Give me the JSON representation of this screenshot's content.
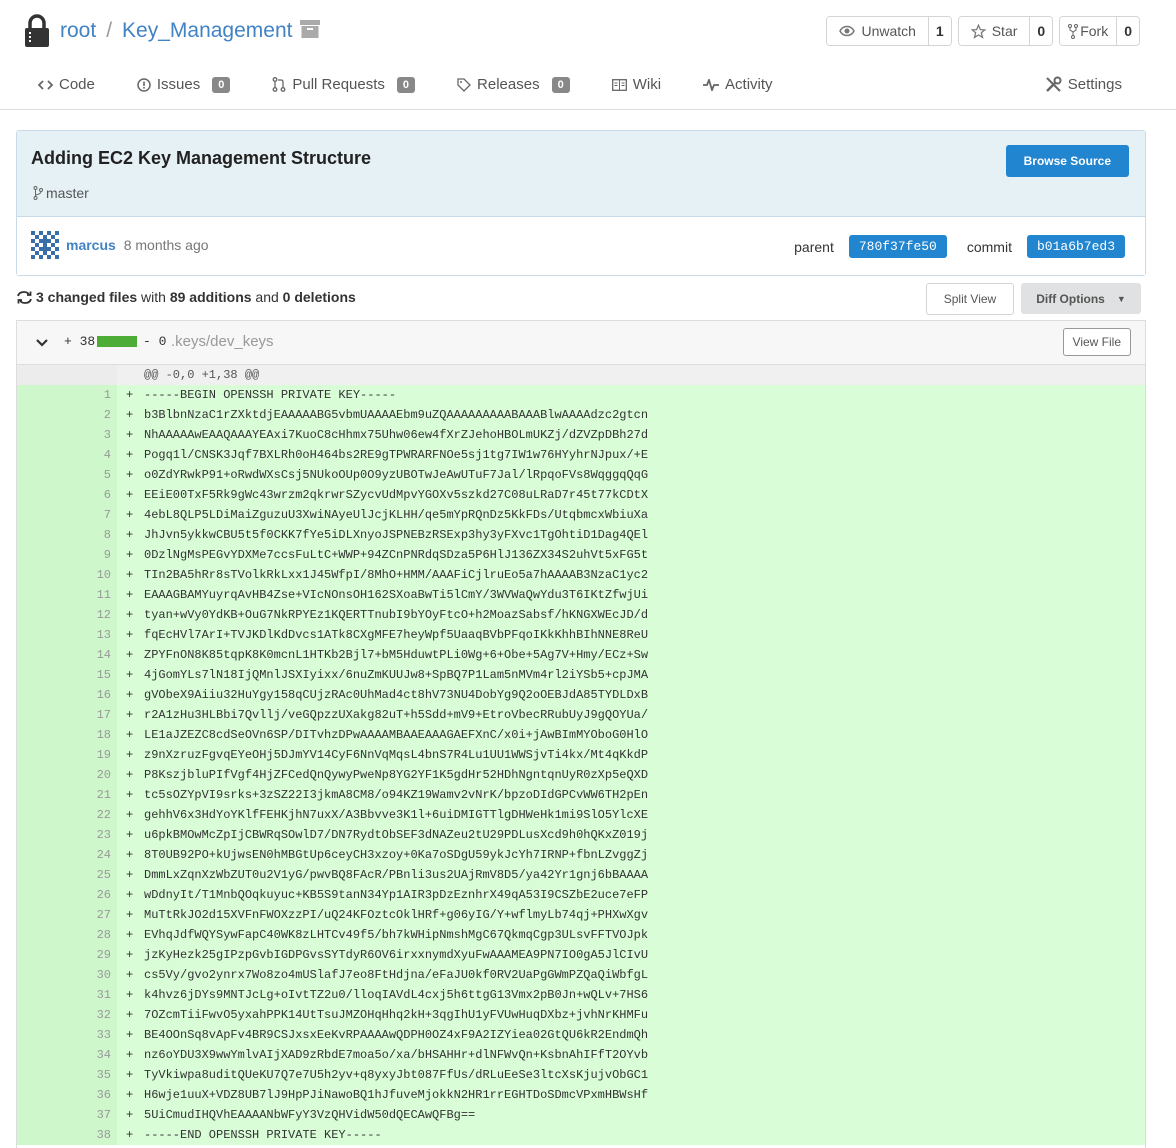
{
  "repo": {
    "owner": "root",
    "separator": "/",
    "name": "Key_Management",
    "buttons": [
      {
        "label": "Unwatch",
        "count": "1",
        "icon": "eye-icon"
      },
      {
        "label": "Star",
        "count": "0",
        "icon": "star-icon"
      },
      {
        "label": "Fork",
        "count": "0",
        "icon": "fork-icon"
      }
    ]
  },
  "tabs": [
    {
      "label": "Code",
      "icon": "code-icon"
    },
    {
      "label": "Issues",
      "badge": "0",
      "icon": "issue-icon"
    },
    {
      "label": "Pull Requests",
      "badge": "0",
      "icon": "pull-request-icon"
    },
    {
      "label": "Releases",
      "badge": "0",
      "icon": "tag-icon"
    },
    {
      "label": "Wiki",
      "icon": "book-icon"
    },
    {
      "label": "Activity",
      "icon": "pulse-icon"
    }
  ],
  "settings_label": "Settings",
  "commit": {
    "title": "Adding EC2 Key Management Structure",
    "branch": "master",
    "browse_label": "Browse Source",
    "author": "marcus",
    "time": "8 months ago",
    "parent_label": "parent",
    "parent_sha": "780f37fe50",
    "commit_label": "commit",
    "commit_sha": "b01a6b7ed3"
  },
  "stats": {
    "files": "3 changed files",
    "with": "with",
    "additions": "89 additions",
    "and": "and",
    "deletions": "0 deletions",
    "split_view": "Split View",
    "diff_options": "Diff Options"
  },
  "file": {
    "additions": "+ 38",
    "deletions": "- 0",
    "path": ".keys/dev_keys",
    "view_file": "View File",
    "hunk": "@@ -0,0 +1,38 @@",
    "lines": [
      "-----BEGIN OPENSSH PRIVATE KEY-----",
      "b3BlbnNzaC1rZXktdjEAAAAABG5vbmUAAAAEbm9uZQAAAAAAAAABAAABlwAAAAdzc2gtcn",
      "NhAAAAAwEAAQAAAYEAxi7KuoC8cHhmx75Uhw06ew4fXrZJehoHBOLmUKZj/dZVZpDBh27d",
      "Pogq1l/CNSK3Jqf7BXLRh0oH464bs2RE9gTPWRARFNOe5sj1tg7IW1w76HYyhrNJpux/+E",
      "o0ZdYRwkP91+oRwdWXsCsj5NUkoOUp0O9yzUBOTwJeAwUTuF7Jal/lRpqoFVs8WqggqQqG",
      "EEiE00TxF5Rk9gWc43wrzm2qkrwrSZycvUdMpvYGOXv5szkd27C08uLRaD7r45t77kCDtX",
      "4ebL8QLP5LDiMaiZguzuU3XwiNAyeUlJcjKLHH/qe5mYpRQnDz5KkFDs/UtqbmcxWbiuXa",
      "JhJvn5ykkwCBU5t5f0CKK7fYe5iDLXnyoJSPNEBzRSExp3hy3yFXvc1TgOhtiD1Dag4QEl",
      "0DzlNgMsPEGvYDXMe7ccsFuLtC+WWP+94ZCnPNRdqSDza5P6HlJ136ZX34S2uhVt5xFG5t",
      "TIn2BA5hRr8sTVolkRkLxx1J45WfpI/8MhO+HMM/AAAFiCjlruEo5a7hAAAAB3NzaC1yc2",
      "EAAAGBAMYuyrqAvHB4Zse+VIcNOnsOH162SXoaBwTi5lCmY/3WVWaQwYdu3T6IKtZfwjUi",
      "tyan+wVy0YdKB+OuG7NkRPYEz1KQERTTnubI9bYOyFtcO+h2MoazSabsf/hKNGXWEcJD/d",
      "fqEcHVl7ArI+TVJKDlKdDvcs1ATk8CXgMFE7heyWpf5UaaqBVbPFqoIKkKhhBIhNNE8ReU",
      "ZPYFnON8K85tqpK8K0mcnL1HTKb2Bjl7+bM5HduwtPLi0Wg+6+Obe+5Ag7V+Hmy/ECz+Sw",
      "4jGomYLs7lN18IjQMnlJSXIyixx/6nuZmKUUJw8+SpBQ7P1Lam5nMVm4rl2iYSb5+cpJMA",
      "gVObeX9Aiiu32HuYgy158qCUjzRAc0UhMad4ct8hV73NU4DobYg9Q2oOEBJdA85TYDLDxB",
      "r2A1zHu3HLBbi7Qvllj/veGQpzzUXakg82uT+h5Sdd+mV9+EtroVbecRRubUyJ9gQOYUa/",
      "LE1aJZEZC8cdSeOVn6SP/DITvhzDPwAAAAMBAAEAAAGAEFXnC/x0i+jAwBImMYOboG0HlO",
      "z9nXzruzFgvqEYeOHj5DJmYV14CyF6NnVqMqsL4bnS7R4Lu1UU1WWSjvTi4kx/Mt4qKkdP",
      "P8KszjbluPIfVgf4HjZFCedQnQywyPweNp8YG2YF1K5gdHr52HDhNgntqnUyR0zXp5eQXD",
      "tc5sOZYpVI9srks+3zSZ22I3jkmA8CM8/o94KZ19Wamv2vNrK/bpzoDIdGPCvWW6TH2pEn",
      "gehhV6x3HdYoYKlfFEHKjhN7uxX/A3Bbvve3K1l+6uiDMIGTTlgDHWeHk1mi9SlO5YlcXE",
      "u6pkBMOwMcZpIjCBWRqSOwlD7/DN7RydtObSEF3dNAZeu2tU29PDLusXcd9h0hQKxZ019j",
      "8T0UB92PO+kUjwsEN0hMBGtUp6ceyCH3xzoy+0Ka7oSDgU59ykJcYh7IRNP+fbnLZvggZj",
      "DmmLxZqnXzWbZUT0u2V1yG/pwvBQ8FAcR/PBnli3us2UAjRmV8D5/ya42Yr1gnj6bBAAAA",
      "wDdnyIt/T1MnbQOqkuyuc+KB5S9tanN34Yp1AIR3pDzEznhrX49qA53I9CSZbE2uce7eFP",
      "MuTtRkJO2d15XVFnFWOXzzPI/uQ24KFOztcOklHRf+g06yIG/Y+wflmyLb74qj+PHXwXgv",
      "EVhqJdfWQYSywFapC40WK8zLHTCv49f5/bh7kWHipNmshMgC67QkmqCgp3ULsvFFTVOJpk",
      "jzKyHezk25gIPzpGvbIGDPGvsSYTdyR6OV6irxxnymdXyuFwAAAMEA9PN7IO0gA5JlCIvU",
      "cs5Vy/gvo2ynrx7Wo8zo4mUSlafJ7eo8FtHdjna/eFaJU0kf0RV2UaPgGWmPZQaQiWbfgL",
      "k4hvz6jDYs9MNTJcLg+oIvtTZ2u0/lloqIAVdL4cxj5h6ttgG13Vmx2pB0Jn+wQLv+7HS6",
      "7OZcmTiiFwvO5yxahPPK14UtTsuJMZOHqHhq2kH+3qgIhU1yFVUwHuqDXbz+jvhNrKHMFu",
      "BE4OOnSq8vApFv4BR9CSJxsxEeKvRPAAAAwQDPH0OZ4xF9A2IZYiea02GtQU6kR2EndmQh",
      "nz6oYDU3X9wwYmlvAIjXAD9zRbdE7moa5o/xa/bHSAHHr+dlNFWvQn+KsbnAhIFfT2OYvb",
      "TyVkiwpa8uditQUeKU7Q7e7U5h2yv+q8yxyJbt087FfUs/dRLuEeSe3ltcXsKjujvObGC1",
      "H6wje1uuX+VDZ8UB7lJ9HpPJiNawoBQ1hJfuveMjokkN2HR1rrEGHTDoSDmcVPxmHBWsHf",
      "5UiCmudIHQVhEAAAANbWFyY3VzQHVidW50dQECAwQFBg==",
      "-----END OPENSSH PRIVATE KEY-----"
    ]
  }
}
